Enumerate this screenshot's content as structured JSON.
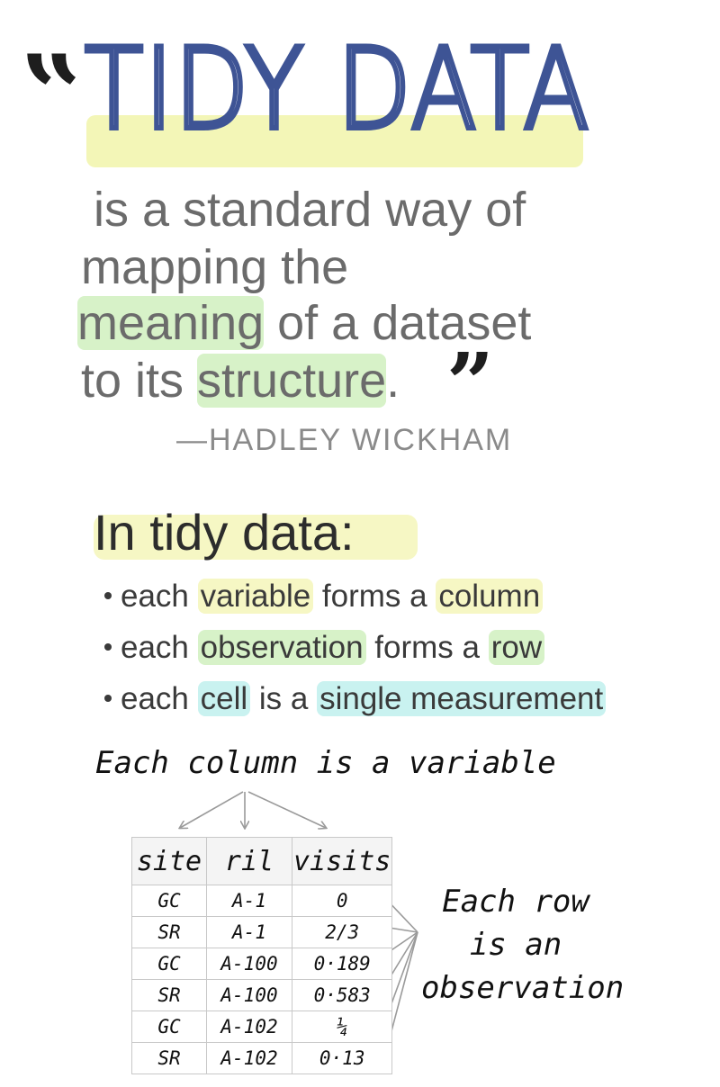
{
  "quote": {
    "title": "TIDY DATA",
    "line1": "is a standard way of",
    "line2": "mapping the",
    "line3_hl": "meaning",
    "line3_rest": " of a dataset",
    "line4_a": "to its ",
    "line4_hl": "structure",
    "line4_b": ".",
    "open_mark": "“",
    "close_mark": "”",
    "attribution": "—HADLEY WICKHAM"
  },
  "section": {
    "heading": "In tidy data:",
    "bullets": [
      {
        "pre": "each ",
        "hl1": "variable",
        "mid": " forms a ",
        "hl2": "column",
        "post": ""
      },
      {
        "pre": "each ",
        "hl1": "observation",
        "mid": " forms a ",
        "hl2": "row",
        "post": ""
      },
      {
        "pre": "each ",
        "hl1": "cell",
        "mid": " is a ",
        "hl2": "single measurement",
        "post": ""
      }
    ]
  },
  "diagram": {
    "column_caption": "Each column is a variable",
    "row_caption": [
      "Each row",
      "is an",
      "observation"
    ],
    "table": {
      "headers": [
        "site",
        "ril",
        "visits"
      ],
      "rows": [
        [
          "GC",
          "A-1",
          "0"
        ],
        [
          "SR",
          "A-1",
          "2/3"
        ],
        [
          "GC",
          "A-100",
          "0·189"
        ],
        [
          "SR",
          "A-100",
          "0·583"
        ],
        [
          "GC",
          "A-102",
          "¼"
        ],
        [
          "SR",
          "A-102",
          "0·13"
        ]
      ]
    }
  },
  "colors": {
    "title_stroke": "#3e5495",
    "highlight_yellow": "#f6f7c4",
    "highlight_green": "#d7f2c8",
    "highlight_cyan": "#c9f2f0",
    "arrow": "#9a9a9a"
  }
}
